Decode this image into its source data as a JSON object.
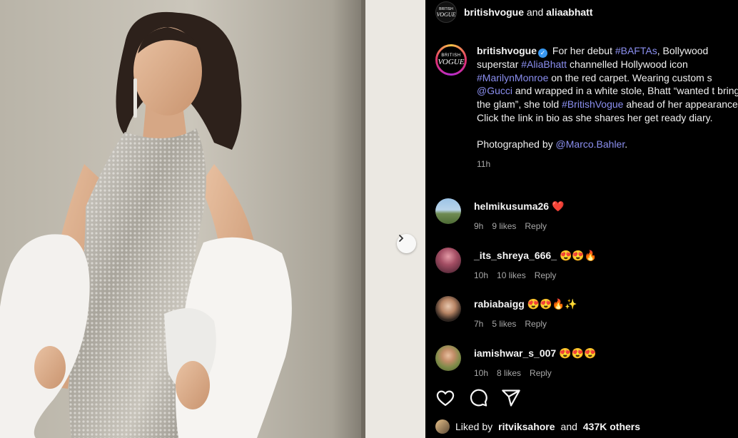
{
  "header": {
    "user1": "britishvogue",
    "and_text": "and",
    "user2": "aliaabhatt",
    "avatar_text": "VOGUE"
  },
  "avatar_label": {
    "top": "BRITISH",
    "main": "VOGUE"
  },
  "caption": {
    "user": "britishvogue",
    "t1": " For her debut ",
    "tag1": "#BAFTAs",
    "t2": ", Bollywood superstar ",
    "tag2": "#AliaBhatt",
    "t3": " channelled Hollywood icon ",
    "tag3": "#MarilynMonroe",
    "t4": " on the red carpet. Wearing custom s ",
    "tag4": "@Gucci",
    "t5": " and wrapped in a white stole, Bhatt “wanted t bring the glam”, she told ",
    "tag5": "#BritishVogue",
    "t6": " ahead of her appearance. Click the link in bio as she shares her get ready diary.",
    "photo_by": "Photographed by ",
    "photo_tag": "@Marco.Bahler",
    "photo_end": ".",
    "time": "11h"
  },
  "comments": [
    {
      "user": "helmikusuma26",
      "text": "❤️",
      "time": "9h",
      "likes": "9 likes",
      "reply": "Reply"
    },
    {
      "user": "_its_shreya_666_",
      "text": "😍😍🔥",
      "time": "10h",
      "likes": "10 likes",
      "reply": "Reply"
    },
    {
      "user": "rabiabaigg",
      "text": "😍😍🔥✨",
      "time": "7h",
      "likes": "5 likes",
      "reply": "Reply"
    },
    {
      "user": "iamishwar_s_007",
      "text": "😍😍😍",
      "time": "10h",
      "likes": "8 likes",
      "reply": "Reply"
    }
  ],
  "actions": {
    "like_icon": "heart-icon",
    "comment_icon": "comment-icon",
    "share_icon": "share-icon"
  },
  "likes": {
    "prefix": "Liked by",
    "user": "ritviksahore",
    "and_text": "and",
    "count": "437K others"
  },
  "colors": {
    "accent": "#8b8ff0",
    "background": "#000000",
    "verified": "#3897f0",
    "heart": "#ff3040"
  }
}
